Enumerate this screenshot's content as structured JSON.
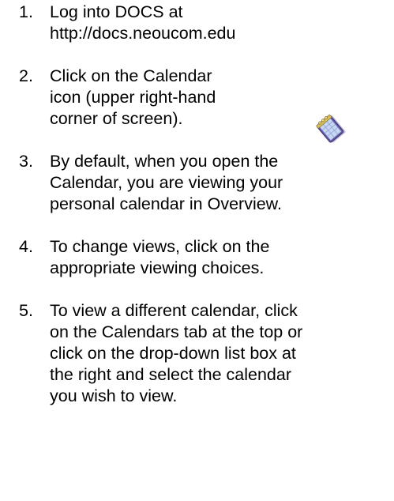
{
  "steps": [
    {
      "number": "1.",
      "lines": [
        "Log into DOCS at",
        "http://docs.neoucom.edu"
      ]
    },
    {
      "number": "2.",
      "lines": [
        "Click on the Calendar",
        "icon (upper right-hand",
        "corner of screen)."
      ]
    },
    {
      "number": "3.",
      "lines": [
        "By default, when you open the",
        "Calendar, you are viewing your",
        "personal calendar in Overview."
      ]
    },
    {
      "number": "4.",
      "lines": [
        "To change views, click on the",
        "appropriate viewing choices."
      ]
    },
    {
      "number": "5.",
      "lines": [
        "To view a different calendar, click",
        "on the Calendars tab at the top or",
        "click on the drop-down list box at",
        "the right and select the calendar",
        "you wish to view."
      ]
    }
  ],
  "icons": {
    "calendar": "calendar-icon"
  }
}
